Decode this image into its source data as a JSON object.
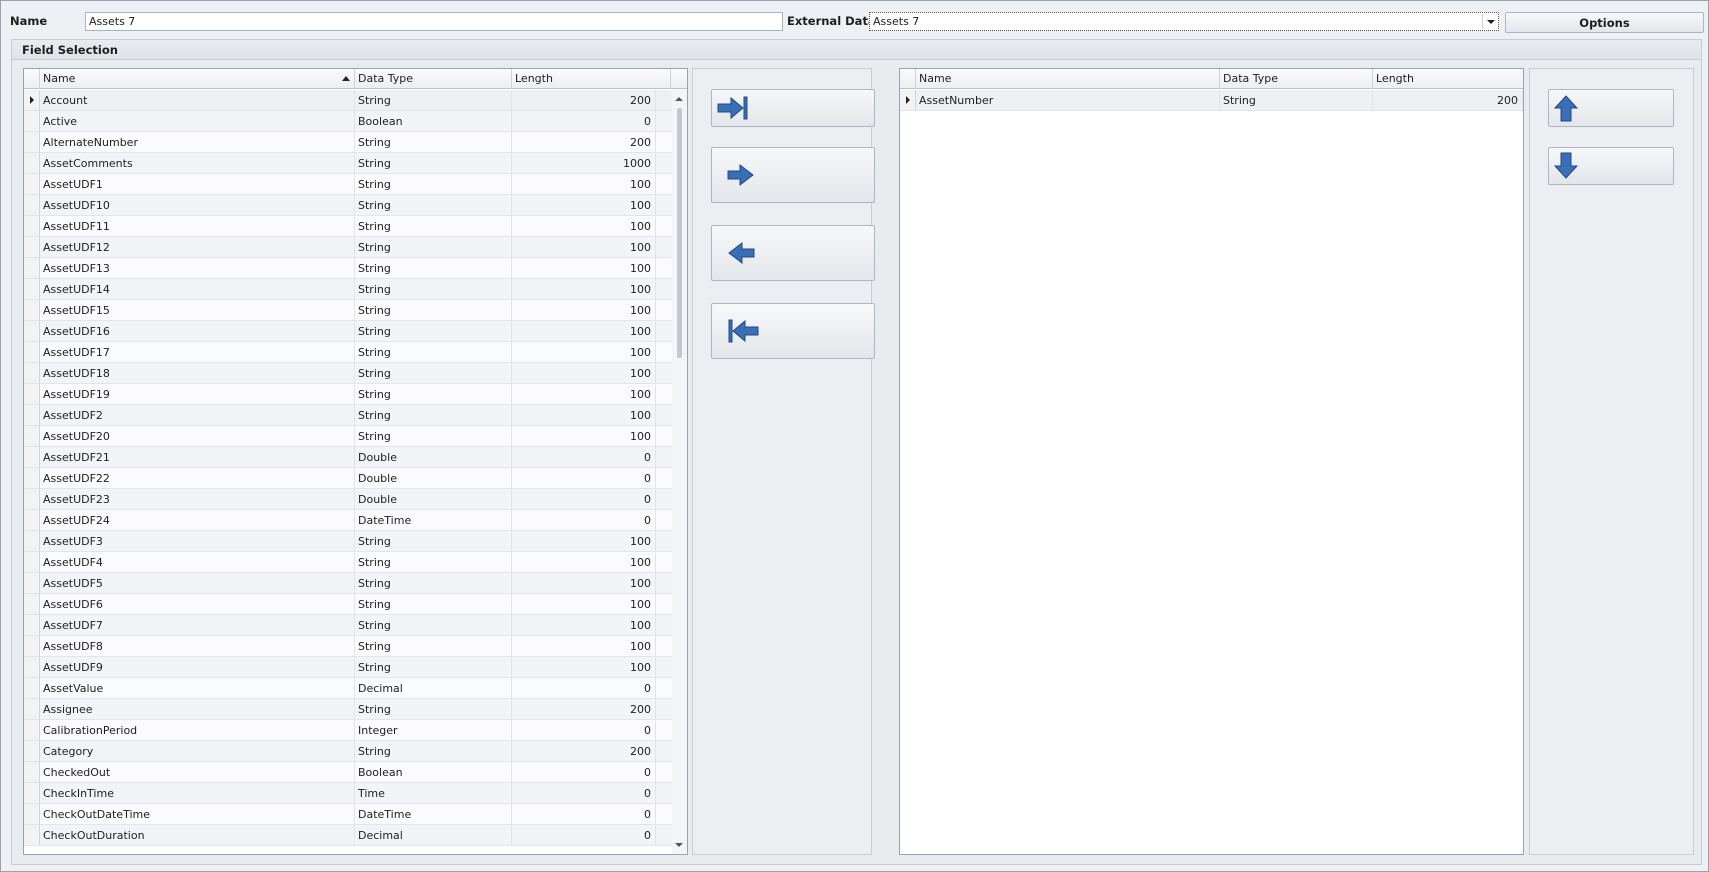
{
  "top": {
    "name_label": "Name",
    "name_value": "Assets 7",
    "external_label": "External Data",
    "external_value": "Assets 7",
    "options_label": "Options"
  },
  "group": {
    "title": "Field Selection"
  },
  "available": {
    "headers": [
      "Name",
      "Data Type",
      "Length"
    ],
    "rows": [
      {
        "name": "Account",
        "type": "String",
        "length": "200"
      },
      {
        "name": "Active",
        "type": "Boolean",
        "length": "0"
      },
      {
        "name": "AlternateNumber",
        "type": "String",
        "length": "200"
      },
      {
        "name": "AssetComments",
        "type": "String",
        "length": "1000"
      },
      {
        "name": "AssetUDF1",
        "type": "String",
        "length": "100"
      },
      {
        "name": "AssetUDF10",
        "type": "String",
        "length": "100"
      },
      {
        "name": "AssetUDF11",
        "type": "String",
        "length": "100"
      },
      {
        "name": "AssetUDF12",
        "type": "String",
        "length": "100"
      },
      {
        "name": "AssetUDF13",
        "type": "String",
        "length": "100"
      },
      {
        "name": "AssetUDF14",
        "type": "String",
        "length": "100"
      },
      {
        "name": "AssetUDF15",
        "type": "String",
        "length": "100"
      },
      {
        "name": "AssetUDF16",
        "type": "String",
        "length": "100"
      },
      {
        "name": "AssetUDF17",
        "type": "String",
        "length": "100"
      },
      {
        "name": "AssetUDF18",
        "type": "String",
        "length": "100"
      },
      {
        "name": "AssetUDF19",
        "type": "String",
        "length": "100"
      },
      {
        "name": "AssetUDF2",
        "type": "String",
        "length": "100"
      },
      {
        "name": "AssetUDF20",
        "type": "String",
        "length": "100"
      },
      {
        "name": "AssetUDF21",
        "type": "Double",
        "length": "0"
      },
      {
        "name": "AssetUDF22",
        "type": "Double",
        "length": "0"
      },
      {
        "name": "AssetUDF23",
        "type": "Double",
        "length": "0"
      },
      {
        "name": "AssetUDF24",
        "type": "DateTime",
        "length": "0"
      },
      {
        "name": "AssetUDF3",
        "type": "String",
        "length": "100"
      },
      {
        "name": "AssetUDF4",
        "type": "String",
        "length": "100"
      },
      {
        "name": "AssetUDF5",
        "type": "String",
        "length": "100"
      },
      {
        "name": "AssetUDF6",
        "type": "String",
        "length": "100"
      },
      {
        "name": "AssetUDF7",
        "type": "String",
        "length": "100"
      },
      {
        "name": "AssetUDF8",
        "type": "String",
        "length": "100"
      },
      {
        "name": "AssetUDF9",
        "type": "String",
        "length": "100"
      },
      {
        "name": "AssetValue",
        "type": "Decimal",
        "length": "0"
      },
      {
        "name": "Assignee",
        "type": "String",
        "length": "200"
      },
      {
        "name": "CalibrationPeriod",
        "type": "Integer",
        "length": "0"
      },
      {
        "name": "Category",
        "type": "String",
        "length": "200"
      },
      {
        "name": "CheckedOut",
        "type": "Boolean",
        "length": "0"
      },
      {
        "name": "CheckInTime",
        "type": "Time",
        "length": "0"
      },
      {
        "name": "CheckOutDateTime",
        "type": "DateTime",
        "length": "0"
      },
      {
        "name": "CheckOutDuration",
        "type": "Decimal",
        "length": "0"
      }
    ]
  },
  "selected": {
    "headers": [
      "Name",
      "Data Type",
      "Length"
    ],
    "rows": [
      {
        "name": "AssetNumber",
        "type": "String",
        "length": "200"
      }
    ]
  },
  "icons": {
    "move_all_right": "arrow-right-bar-icon",
    "move_right": "arrow-right-icon",
    "move_left": "arrow-left-icon",
    "move_all_left": "arrow-left-bar-icon",
    "move_up": "arrow-up-icon",
    "move_down": "arrow-down-icon"
  },
  "colors": {
    "arrow_fill": "#3a6eb5",
    "arrow_stroke": "#1f4a87"
  }
}
